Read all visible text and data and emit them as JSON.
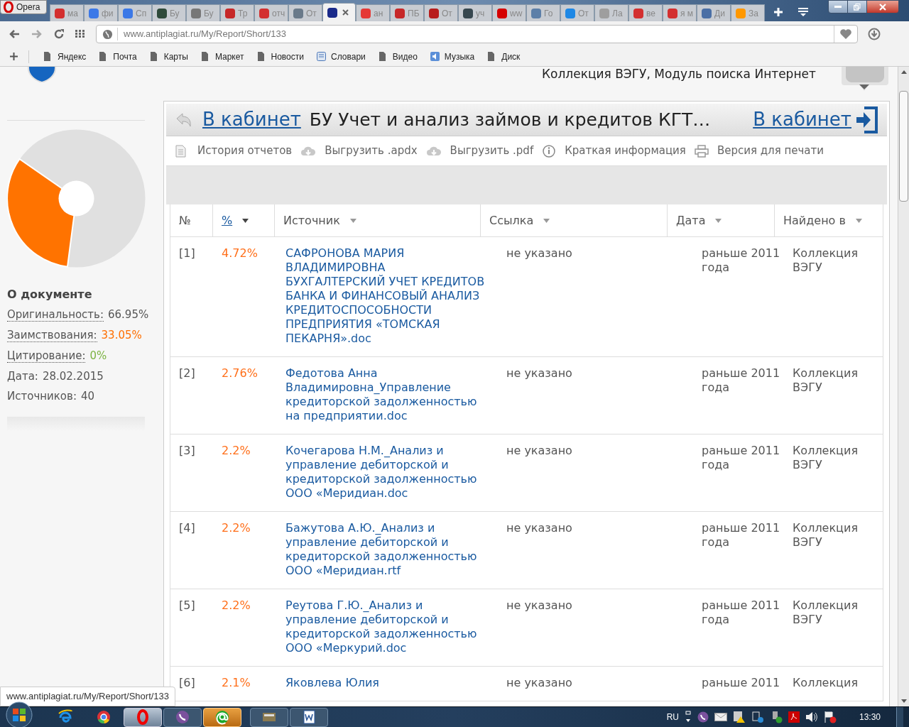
{
  "browser": {
    "menu_label": "Opera",
    "tabs": [
      {
        "label": "ма",
        "selected": false,
        "color": "#d32f2f"
      },
      {
        "label": "фи",
        "selected": false,
        "color": "#3b78e7"
      },
      {
        "label": "Сп",
        "selected": false,
        "color": "#3b78e7"
      },
      {
        "label": "Бу",
        "selected": false,
        "color": "#2e4a3a"
      },
      {
        "label": "Бу",
        "selected": false,
        "color": "#777777"
      },
      {
        "label": "Тр",
        "selected": false,
        "color": "#c62828"
      },
      {
        "label": "отч",
        "selected": false,
        "color": "#d32f2f"
      },
      {
        "label": "От",
        "selected": false,
        "color": "#6a7a8a"
      },
      {
        "selected": true,
        "color": "#1a2a8a"
      },
      {
        "label": "ан",
        "selected": false,
        "color": "#e53935"
      },
      {
        "label": "ПБ",
        "selected": false,
        "color": "#c62828"
      },
      {
        "label": "От",
        "selected": false,
        "color": "#b71c1c"
      },
      {
        "label": "уч",
        "selected": false,
        "color": "#37474f"
      },
      {
        "label": "ww",
        "selected": false,
        "color": "#d50000"
      },
      {
        "label": "Го",
        "selected": false,
        "color": "#5c7fa8"
      },
      {
        "label": "От",
        "selected": false,
        "color": "#1e88e5"
      },
      {
        "label": "Ла",
        "selected": false,
        "color": "#9e9e9e"
      },
      {
        "label": "ве",
        "selected": false,
        "color": "#d32f2f"
      },
      {
        "label": "я м",
        "selected": false,
        "color": "#d32f2f"
      },
      {
        "label": "Ди",
        "selected": false,
        "color": "#4a6fa5"
      },
      {
        "label": "За",
        "selected": false,
        "color": "#ff9800"
      }
    ],
    "address": "www.antiplagiat.ru/My/Report/Short/133",
    "bookmarks": [
      {
        "label": "Яндекс",
        "kind": "page"
      },
      {
        "label": "Почта",
        "kind": "page"
      },
      {
        "label": "Карты",
        "kind": "page"
      },
      {
        "label": "Маркет",
        "kind": "page"
      },
      {
        "label": "Новости",
        "kind": "page"
      },
      {
        "label": "Словари",
        "kind": "app"
      },
      {
        "label": "Видео",
        "kind": "page"
      },
      {
        "label": "Музыка",
        "kind": "sound"
      },
      {
        "label": "Диск",
        "kind": "page"
      }
    ]
  },
  "page": {
    "collections": "Коллекция ВЭГУ, Модуль поиска Интернет",
    "sidebar": {
      "title": "О документе",
      "stats": [
        {
          "label": "Оригинальность:",
          "value": "66.95%",
          "kind": "link",
          "color": "#555555"
        },
        {
          "label": "Заимствования:",
          "value": "33.05%",
          "kind": "link",
          "color": "#ff6f00"
        },
        {
          "label": "Цитирование:",
          "value": "0%",
          "kind": "link",
          "color": "#7cb342"
        },
        {
          "label": "Дата:",
          "value": "28.02.2015",
          "kind": "plain",
          "color": "#555555"
        },
        {
          "label": "Источников:",
          "value": "40",
          "kind": "plain",
          "color": "#555555"
        }
      ]
    },
    "report": {
      "back_link": "В кабинет",
      "title": "БУ Учет и анализ займов и кредитов КГТ…",
      "cabinet_link": "В кабинет",
      "toolbar": [
        {
          "label": "История отчетов",
          "kind": "document"
        },
        {
          "label": "Выгрузить .apdx",
          "kind": "cloud"
        },
        {
          "label": "Выгрузить .pdf",
          "kind": "cloud"
        },
        {
          "label": "Краткая информация",
          "kind": "info"
        },
        {
          "label": "Версия для печати",
          "kind": "printer"
        }
      ],
      "columns": [
        {
          "label": "№",
          "kind": "plain",
          "sortable": false
        },
        {
          "label": "%",
          "kind": "link",
          "sortable": true
        },
        {
          "label": "Источник",
          "kind": "plain",
          "sortable": true
        },
        {
          "label": "Ссылка",
          "kind": "plain",
          "sortable": true
        },
        {
          "label": "Дата",
          "kind": "plain",
          "sortable": true
        },
        {
          "label": "Найдено в",
          "kind": "plain",
          "sortable": true
        }
      ],
      "rows": [
        {
          "number": "[1]",
          "percent": "4.72%",
          "source": "САФРОНОВА МАРИЯ ВЛАДИМИРОВНА БУХГАЛТЕРСКИЙ УЧЕТ КРЕДИТОВ БАНКА И ФИНАНСОВЫЙ АНАЛИЗ КРЕДИТОСПОСОБНОСТИ ПРЕДПРИЯТИЯ «ТОМСКАЯ ПЕКАРНЯ».doc",
          "link": "не указано",
          "date": "раньше 2011 года",
          "found_in": "Коллекция ВЭГУ"
        },
        {
          "number": "[2]",
          "percent": "2.76%",
          "source": "Федотова Анна Владимировна_Управление кредиторской задолженностью на предприятии.doc",
          "link": "не указано",
          "date": "раньше 2011 года",
          "found_in": "Коллекция ВЭГУ"
        },
        {
          "number": "[3]",
          "percent": "2.2%",
          "source": "Кочегарова Н.М._Анализ и управление дебиторской и кредиторской задолженностью ООО «Меридиан.doc",
          "link": "не указано",
          "date": "раньше 2011 года",
          "found_in": "Коллекция ВЭГУ"
        },
        {
          "number": "[4]",
          "percent": "2.2%",
          "source": "Бажутова А.Ю._Анализ и управление дебиторской и кредиторской задолженностью ООО «Меридиан.rtf",
          "link": "не указано",
          "date": "раньше 2011 года",
          "found_in": "Коллекция ВЭГУ"
        },
        {
          "number": "[5]",
          "percent": "2.2%",
          "source": "Реутова Г.Ю._Анализ и управление дебиторской и кредиторской задолженностью ООО «Меркурий.doc",
          "link": "не указано",
          "date": "раньше 2011 года",
          "found_in": "Коллекция ВЭГУ"
        },
        {
          "number": "[6]",
          "percent": "2.1%",
          "source": "Яковлева Юлия",
          "link": "не указано",
          "date": "раньше 2011",
          "found_in": "Коллекция"
        }
      ]
    },
    "status_url": "www.antiplagiat.ru/My/Report/Short/133"
  },
  "taskbar": {
    "apps": [
      {
        "kind": "ie",
        "active": false
      },
      {
        "kind": "chrome",
        "active": false
      },
      {
        "kind": "opera",
        "active": true
      },
      {
        "kind": "viber",
        "active": false
      },
      {
        "kind": "agent",
        "active": false
      },
      {
        "kind": "app",
        "active": false
      },
      {
        "kind": "word",
        "active": false
      }
    ],
    "language": "RU",
    "clock": "13:30"
  }
}
